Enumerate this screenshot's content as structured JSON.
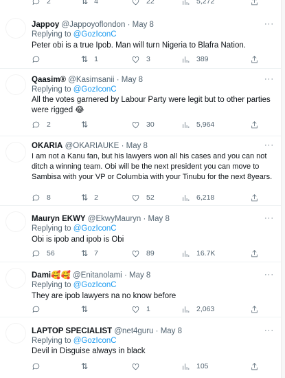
{
  "top_bar": {
    "reply_count": "2",
    "retweet_count": "4",
    "like_count": "22",
    "view_count": "5,272"
  },
  "tweets": [
    {
      "name": "Jappoy",
      "handle": "@Jappoyoflondon",
      "date": "May 8",
      "replying_label": "Replying to",
      "replying_to": "@GozIconC",
      "text": "Peter obi is a true Ipob. Man will turn Nigeria to Blafra Nation.",
      "reply_count": "",
      "retweet_count": "1",
      "like_count": "3",
      "view_count": "389"
    },
    {
      "name": "Qaasim®",
      "handle": "@Kasimsanii",
      "date": "May 8",
      "replying_label": "Replying to",
      "replying_to": "@GozIconC",
      "text": "All the votes garnered by Labour Party were legit but to other parties were rigged 😂",
      "reply_count": "2",
      "retweet_count": "",
      "like_count": "30",
      "view_count": "5,964"
    },
    {
      "name": "OKARIA",
      "handle": "@OKARIAUKE",
      "date": "May 8",
      "replying_label": "",
      "replying_to": "",
      "text": "I am not a Kanu fan, but his lawyers won all his cases and you can not ditch a winning team. Obi will be the next president you can move to Sambisa with your VP or Columbia with your Tinubu for the next 8years.",
      "reply_count": "8",
      "retweet_count": "2",
      "like_count": "52",
      "view_count": "6,218"
    },
    {
      "name": "Mauryn EKWY",
      "handle": "@EkwyMauryn",
      "date": "May 8",
      "replying_label": "Replying to",
      "replying_to": "@GozIconC",
      "text": "Obi is ipob and ipob is Obi",
      "reply_count": "56",
      "retweet_count": "7",
      "like_count": "89",
      "view_count": "16.7K"
    },
    {
      "name": "Dami🥰🥰",
      "handle": "@Enitanolami",
      "date": "May 8",
      "replying_label": "Replying to",
      "replying_to": "@GozIconC",
      "text": "They are ipob lawyers na no know before",
      "reply_count": "",
      "retweet_count": "",
      "like_count": "1",
      "view_count": "2,063"
    },
    {
      "name": "LAPTOP SPECIALIST",
      "handle": "@net4guru",
      "date": "May 8",
      "replying_label": "Replying to",
      "replying_to": "@GozIconC",
      "text": "Devil in Disguise always in black",
      "reply_count": "",
      "retweet_count": "",
      "like_count": "",
      "view_count": "105"
    }
  ],
  "icons": {
    "reply": "comment-icon",
    "retweet": "retweet-icon",
    "like": "heart-icon",
    "views": "views-chart-icon",
    "share": "share-icon",
    "more": "more-dots-icon"
  },
  "colors": {
    "accent": "#1d9bf0",
    "secondary_text": "#536471",
    "primary_text": "#0f1419",
    "divider": "#eff3f4"
  },
  "dot": "·",
  "more_glyph": "···",
  "retweet_glyph": "⇅"
}
